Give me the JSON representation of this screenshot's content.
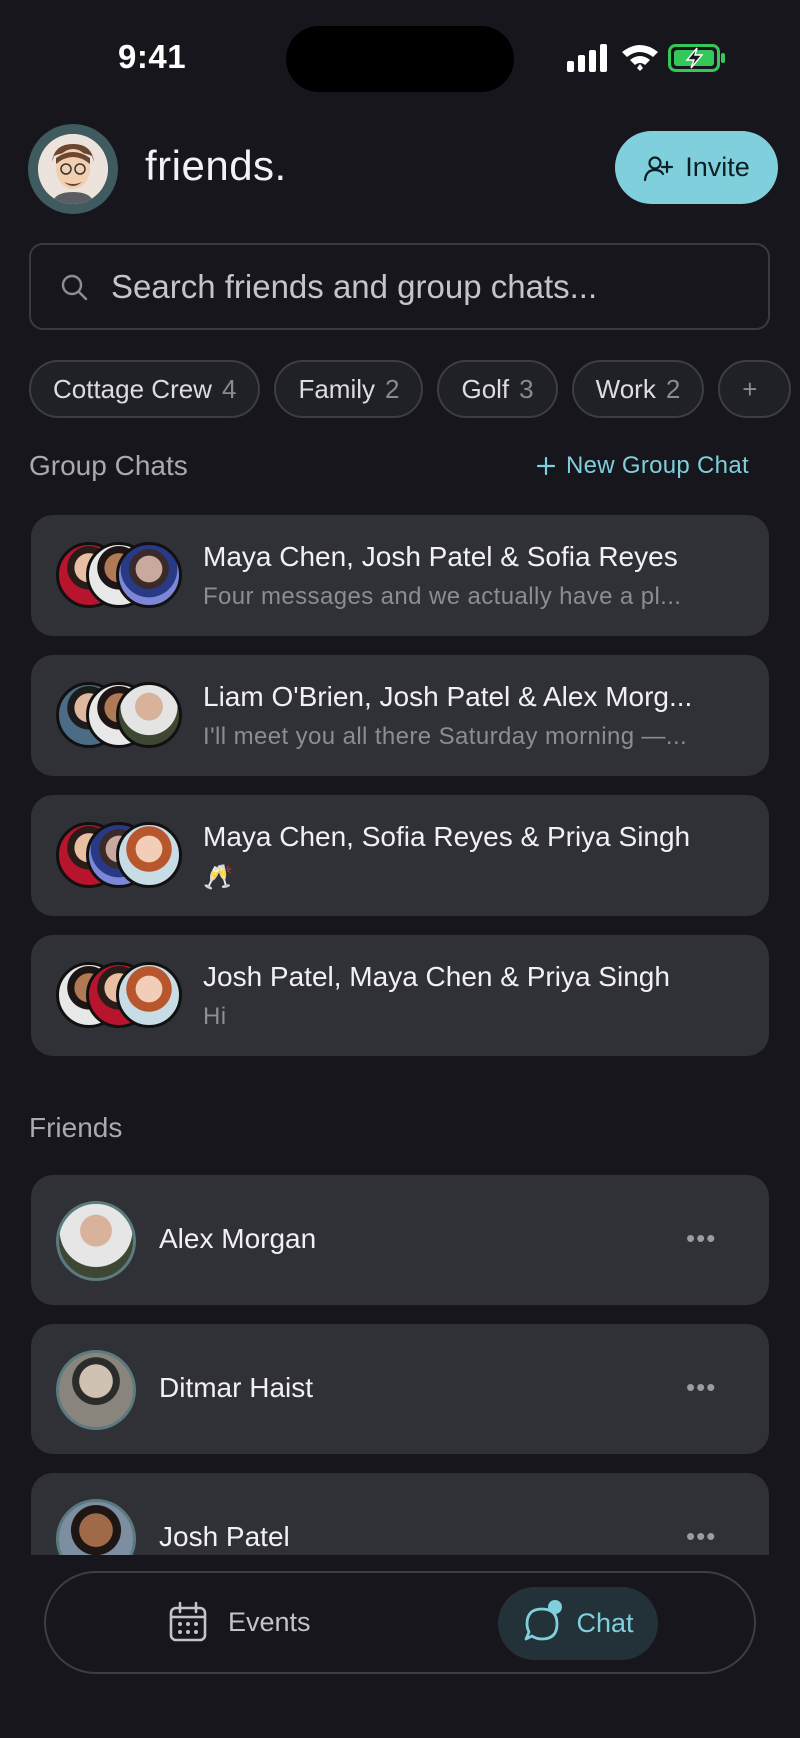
{
  "status_bar": {
    "time": "9:41"
  },
  "header": {
    "app_title": "friends.",
    "invite_label": "Invite"
  },
  "search": {
    "placeholder": "Search friends and group chats..."
  },
  "chips": [
    {
      "label": "Cottage Crew",
      "count": "4"
    },
    {
      "label": "Family",
      "count": "2"
    },
    {
      "label": "Golf",
      "count": "3"
    },
    {
      "label": "Work",
      "count": "2"
    },
    {
      "label": "+",
      "count": ""
    }
  ],
  "group_chats": {
    "title": "Group Chats",
    "new_label": "New Group Chat",
    "items": [
      {
        "name": "Maya Chen, Josh Patel & Sofia Reyes",
        "message": "Four messages and we actually have a pl..."
      },
      {
        "name": "Liam O'Brien, Josh Patel & Alex Morg...",
        "message": "I'll meet you all there Saturday morning —..."
      },
      {
        "name": "Maya Chen, Sofia Reyes & Priya Singh",
        "message": "🥂"
      },
      {
        "name": "Josh Patel, Maya Chen & Priya Singh",
        "message": "Hi"
      }
    ]
  },
  "friends": {
    "title": "Friends",
    "items": [
      {
        "name": "Alex Morgan",
        "more": "•••"
      },
      {
        "name": "Ditmar Haist",
        "more": "•••"
      },
      {
        "name": "Josh Patel",
        "more": "•••"
      }
    ]
  },
  "bottom_nav": {
    "events_label": "Events",
    "chat_label": "Chat"
  },
  "colors": {
    "accent": "#7fd0dc",
    "background": "#16161c",
    "card": "#303037"
  }
}
